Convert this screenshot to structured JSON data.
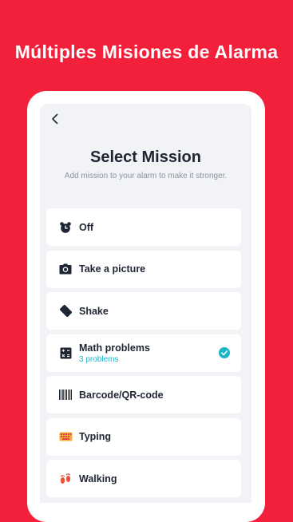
{
  "promo": {
    "title": "Múltiples Misiones de Alarma"
  },
  "screen": {
    "back_icon": "chevron-left-icon",
    "title": "Select Mission",
    "subtitle": "Add mission to your alarm to make it stronger."
  },
  "missions": [
    {
      "label": "Off",
      "icon": "alarm-clock-icon"
    },
    {
      "label": "Take a picture",
      "icon": "camera-icon"
    },
    {
      "label": "Shake",
      "icon": "phone-shake-icon"
    },
    {
      "label": "Math problems",
      "sub": "3 problems",
      "icon": "calculator-icon",
      "selected": true
    },
    {
      "label": "Barcode/QR-code",
      "icon": "barcode-icon"
    },
    {
      "label": "Typing",
      "icon": "keyboard-icon"
    },
    {
      "label": "Walking",
      "icon": "footprints-icon"
    }
  ],
  "colors": {
    "brand_red": "#F2203A",
    "accent_teal": "#1FB5C8",
    "text_dark": "#1E2633"
  }
}
